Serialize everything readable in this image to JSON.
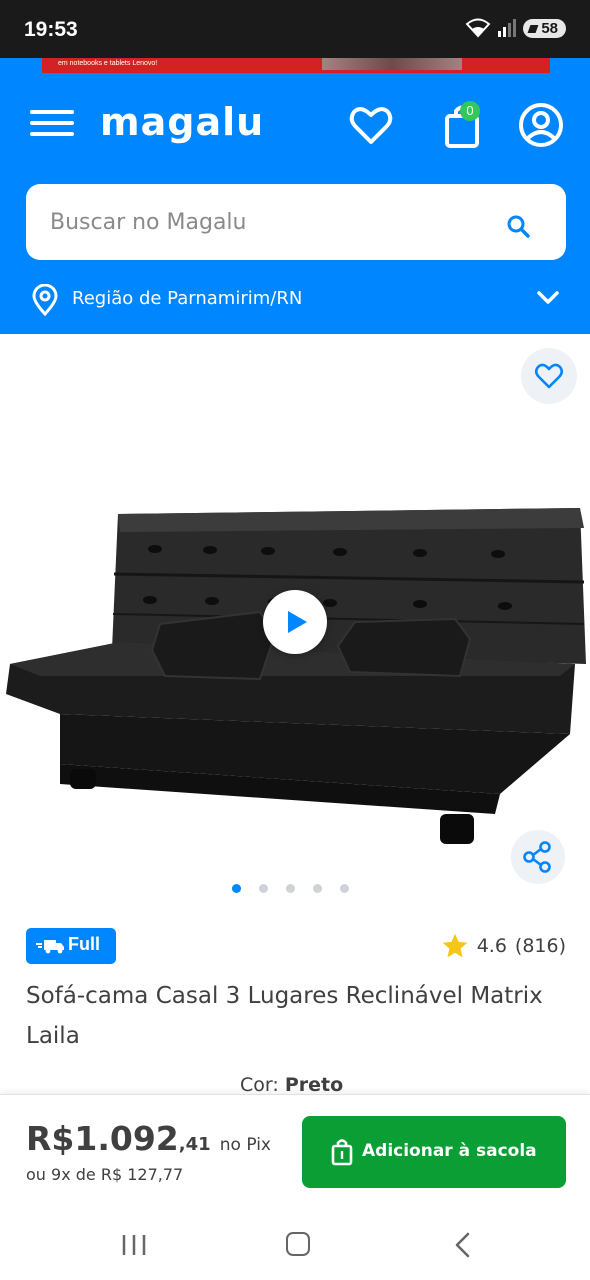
{
  "status_bar": {
    "time": "19:53",
    "battery": "58"
  },
  "header": {
    "promo_text": "em notebooks e tablets Lenovo!",
    "logo": "magalu",
    "bag_count": "0",
    "search": {
      "placeholder": "Buscar no Magalu"
    },
    "region": "Região de Parnamirim/RN"
  },
  "gallery": {
    "image_count": 5,
    "active_index": 0
  },
  "product": {
    "badge": "Full",
    "rating": "4.6",
    "reviews": "(816)",
    "title": "Sofá-cama Casal 3 Lugares Reclinável Matrix Laila",
    "color_label": "Cor:",
    "color_value": "Preto"
  },
  "buy_bar": {
    "price_main": "R$1.092",
    "price_cents": ",41",
    "price_suffix": "no Pix",
    "installments": "ou 9x de R$ 127,77",
    "add_button": "Adicionar à sacola"
  },
  "colors": {
    "brand_blue": "#0086ff",
    "buy_green": "#0a9e35",
    "full_blue": "#0086ff",
    "star": "#f5c518"
  },
  "icons": [
    "menu-icon",
    "heart-icon",
    "bag-icon",
    "user-icon",
    "search-icon",
    "location-pin-icon",
    "chevron-down-icon",
    "play-icon",
    "share-icon",
    "truck-icon",
    "star-icon"
  ]
}
